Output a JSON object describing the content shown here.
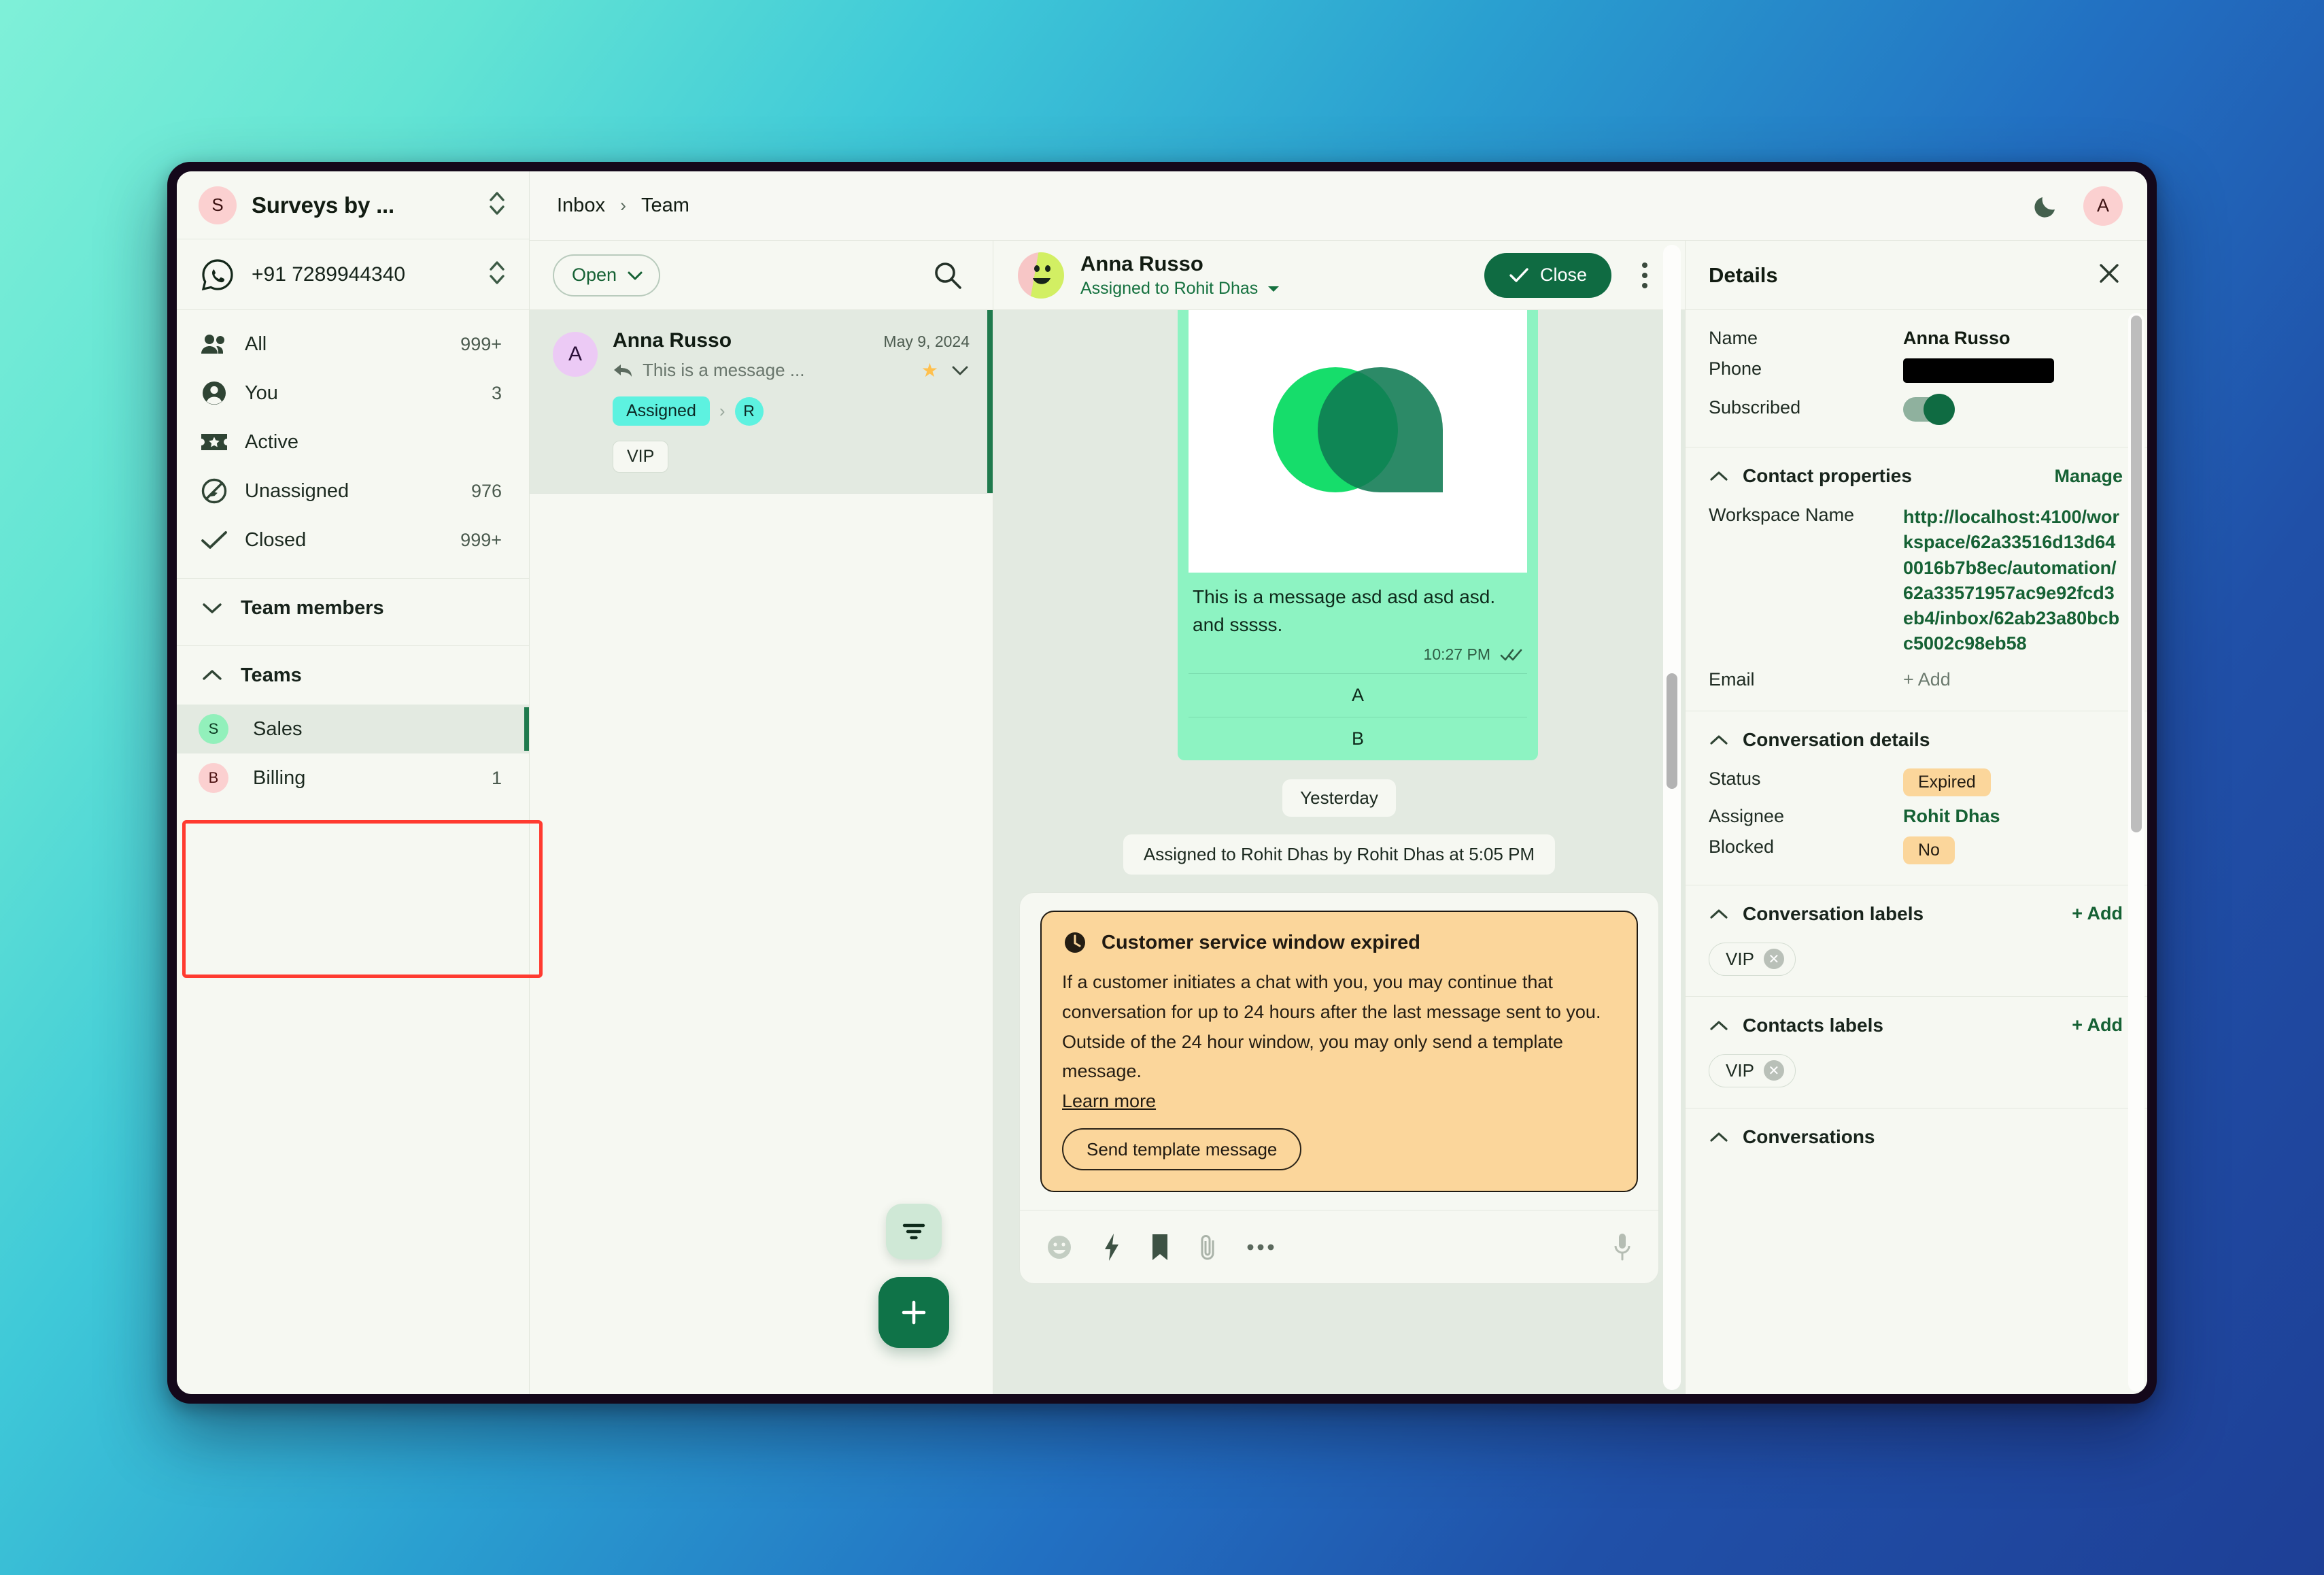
{
  "topbar": {
    "breadcrumb": [
      "Inbox",
      "Team"
    ],
    "separator": "›",
    "theme_toggle": "dark-mode-moon",
    "user_initial": "A"
  },
  "sidebar": {
    "workspace": {
      "initial": "S",
      "name": "Surveys by ..."
    },
    "channel": {
      "icon": "whatsapp-icon",
      "number": "+91 7289944340"
    },
    "nav": [
      {
        "icon": "people-icon",
        "label": "All",
        "count": "999+"
      },
      {
        "icon": "person-icon",
        "label": "You",
        "count": "3"
      },
      {
        "icon": "ticket-star-icon",
        "label": "Active",
        "count": ""
      },
      {
        "icon": "block-icon",
        "label": "Unassigned",
        "count": "976"
      },
      {
        "icon": "check-icon",
        "label": "Closed",
        "count": "999+"
      }
    ],
    "team_members_group": {
      "label": "Team members",
      "expanded": false
    },
    "teams_group": {
      "label": "Teams",
      "expanded": true
    },
    "teams": [
      {
        "initial": "S",
        "label": "Sales",
        "count": "",
        "active": true,
        "color": "#92f0bb"
      },
      {
        "initial": "B",
        "label": "Billing",
        "count": "1",
        "active": false,
        "color": "#fbd0d0"
      }
    ],
    "highlight_color": "#ff3b30"
  },
  "list": {
    "filter_label": "Open",
    "search_icon": "search-icon",
    "conversations": [
      {
        "avatar_initial": "A",
        "name": "Anna Russo",
        "date": "May 9, 2024",
        "preview": "This is a message ...",
        "preview_icon": "reply-icon",
        "starred": true,
        "status_chip": "Assigned",
        "assignee_initial": "R",
        "labels": [
          "VIP"
        ]
      }
    ],
    "fab_filter": "filter-icon",
    "fab_add": "plus-icon"
  },
  "chat": {
    "contact_name": "Anna Russo",
    "assigned_text": "Assigned to Rohit Dhas",
    "close_button": "Close",
    "more_menu": "kebab-menu",
    "message": {
      "text": "This is a message asd asd asd asd. and sssss.",
      "time": "10:27 PM",
      "read_state": "double-check",
      "buttons": [
        "A",
        "B"
      ]
    },
    "date_chip": "Yesterday",
    "system_note": "Assigned to Rohit Dhas by Rohit Dhas at 5:05 PM",
    "alert": {
      "icon": "clock-icon",
      "title": "Customer service window expired",
      "body": "If a customer initiates a chat with you, you may continue that conversation for up to 24 hours after the last message sent to you. Outside of the 24 hour window, you may only send a template message.",
      "link": "Learn more",
      "button": "Send template message",
      "bg": "#fbd69b"
    },
    "toolbar_icons": [
      "emoji-icon",
      "lightning-icon",
      "bookmark-icon",
      "attachment-icon",
      "ellipsis-icon",
      "microphone-icon"
    ]
  },
  "details": {
    "title": "Details",
    "close_icon": "close-icon",
    "contact": {
      "name_label": "Name",
      "name_value": "Anna Russo",
      "phone_label": "Phone",
      "phone_value": "",
      "subscribed_label": "Subscribed",
      "subscribed_on": true
    },
    "contact_properties": {
      "heading": "Contact properties",
      "action": "Manage",
      "rows": [
        {
          "key": "Workspace Name",
          "value": "http://localhost:4100/workspace/62a33516d13d640016b7b8ec/automation/62a33571957ac9e92fcd3eb4/inbox/62ab23a80bcbc5002c98eb58",
          "is_link": true
        },
        {
          "key": "Email",
          "value": "+ Add",
          "is_link": false
        }
      ]
    },
    "conversation_details": {
      "heading": "Conversation details",
      "rows": [
        {
          "key": "Status",
          "value": "Expired",
          "style": "badge"
        },
        {
          "key": "Assignee",
          "value": "Rohit Dhas",
          "style": "link"
        },
        {
          "key": "Blocked",
          "value": "No",
          "style": "badge"
        }
      ]
    },
    "conversation_labels": {
      "heading": "Conversation labels",
      "action": "+ Add",
      "tags": [
        "VIP"
      ]
    },
    "contacts_labels": {
      "heading": "Contacts labels",
      "action": "+ Add",
      "tags": [
        "VIP"
      ]
    },
    "conversations_section": {
      "heading": "Conversations"
    }
  },
  "colors": {
    "accent_green": "#0f6b42",
    "bubble_green": "#8df3c2",
    "alert_amber": "#fbd69b",
    "panel_bg": "#f6f8f2",
    "chat_bg": "#e3eae1",
    "highlight_red": "#ff3b30"
  }
}
